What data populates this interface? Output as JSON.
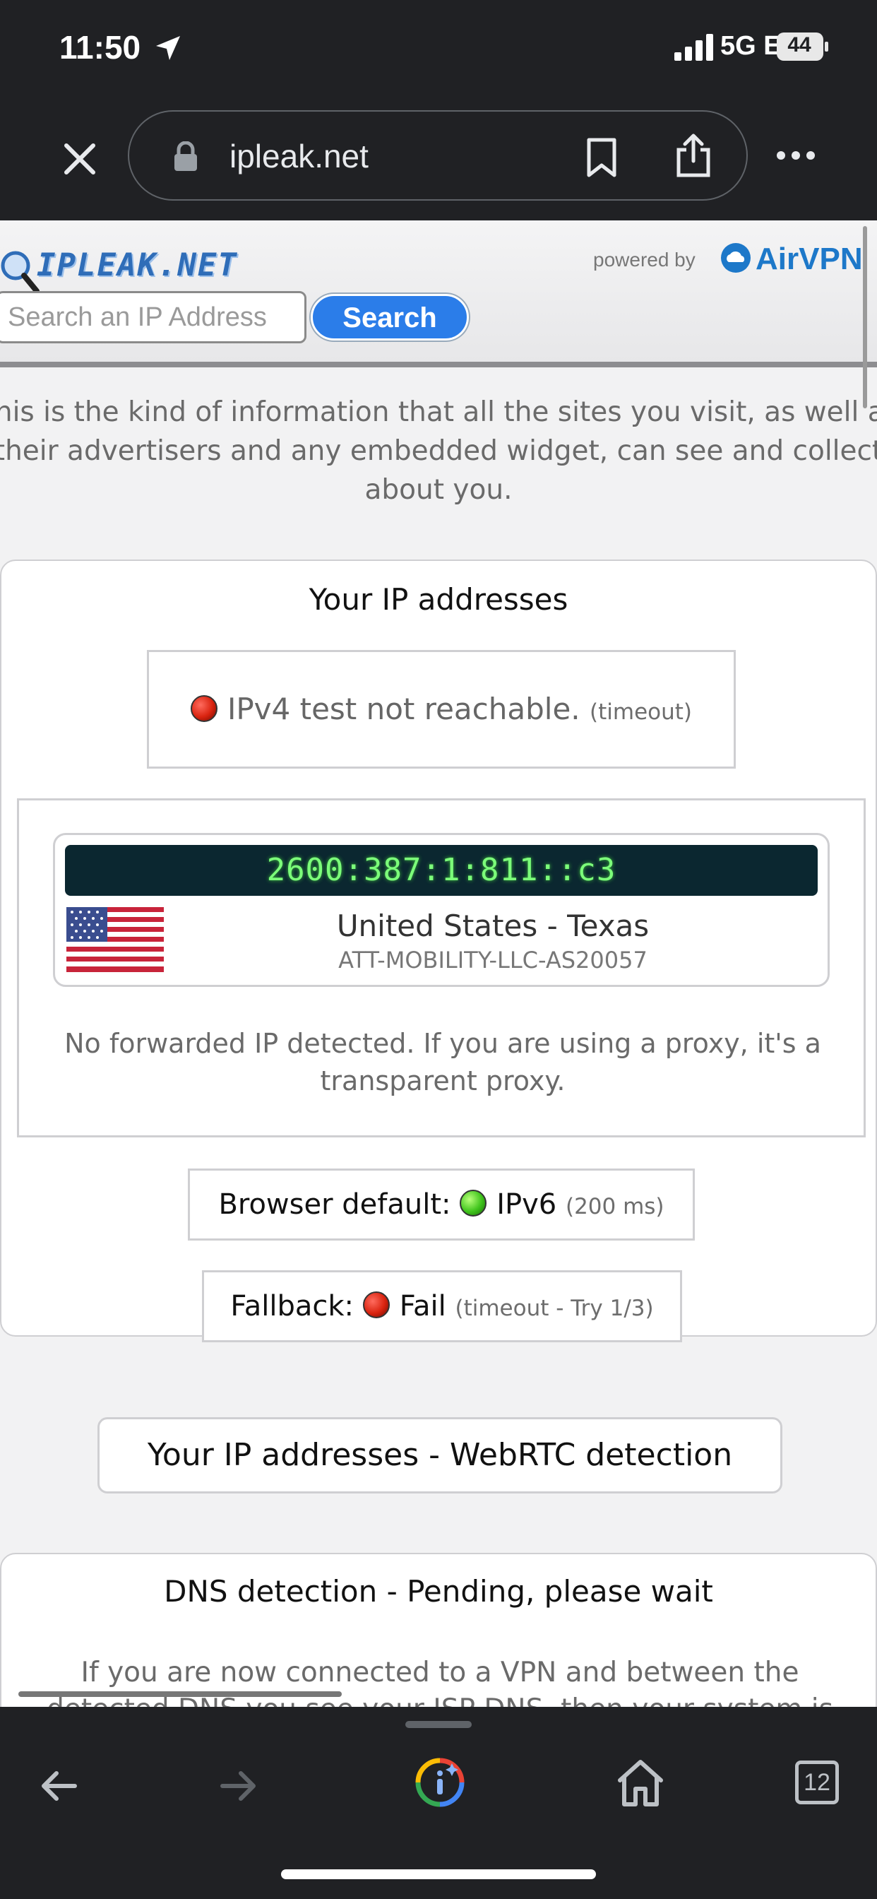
{
  "status_bar": {
    "time": "11:50",
    "network": "5G E",
    "battery": "44"
  },
  "browser": {
    "url": "ipleak.net",
    "tab_count": "12"
  },
  "site": {
    "logo_text": "IPLEAK.NET",
    "powered_by": "powered by",
    "airvpn": "AirVPN",
    "search_placeholder": "Search an IP Address",
    "search_button": "Search",
    "intro": "This is the kind of information that all the sites you visit, as well as their advertisers and any embedded widget, can see and collect about you."
  },
  "ip_section": {
    "title": "Your IP addresses",
    "ipv4_status": "IPv4 test not reachable.",
    "ipv4_note": "(timeout)",
    "ipv6_address": "2600:387:1:811::c3",
    "country": "United States - Texas",
    "isp": "ATT-MOBILITY-LLC-AS20057",
    "forwarded": "No forwarded IP detected. If you are using a proxy, it's a transparent proxy.",
    "browser_default_label": "Browser default:",
    "browser_default_value": "IPv6",
    "browser_default_note": "(200 ms)",
    "fallback_label": "Fallback:",
    "fallback_value": "Fail",
    "fallback_note": "(timeout - Try 1/3)"
  },
  "webrtc_button": "Your IP addresses - WebRTC detection",
  "dns_section": {
    "title": "DNS detection - Pending, please wait",
    "text": "If you are now connected to a VPN and between the detected DNS you see your ISP DNS, then your system is"
  },
  "colors": {
    "chrome_bg": "#202124",
    "accent_blue": "#2b7de9",
    "status_red": "#d9230f",
    "status_green": "#3fc41c",
    "ip_band_bg": "#0b2730",
    "ip_band_text": "#7cff7a"
  },
  "icons": [
    "location-arrow-icon",
    "signal-icon",
    "battery-icon",
    "close-icon",
    "lock-icon",
    "bookmark-icon",
    "share-icon",
    "more-icon",
    "magnifier-icon",
    "airvpn-cloud-icon",
    "us-flag-icon",
    "back-icon",
    "forward-icon",
    "google-lens-icon",
    "home-icon",
    "tabs-icon"
  ]
}
